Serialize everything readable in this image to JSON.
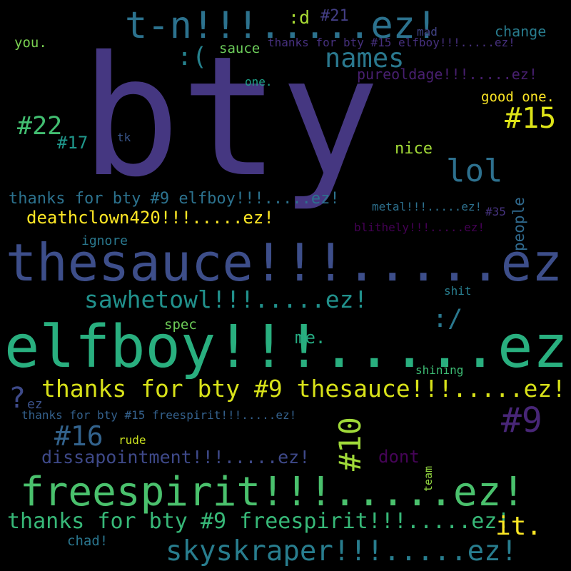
{
  "words": [
    {
      "text": "bty",
      "color": "#453781"
    },
    {
      "text": "thesauce!!!.....ez!",
      "color": "#3d4e8a"
    },
    {
      "text": "elfboy!!!.....ez!",
      "color": "#29af7f"
    },
    {
      "text": "freespirit!!!.....ez!",
      "color": "#4ac16d"
    },
    {
      "text": "t-n!!!.....ez!",
      "color": "#2c728e"
    },
    {
      "text": "thanks for bty #9 thesauce!!!.....ez!",
      "color": "#d8e219"
    },
    {
      "text": "skyskraper!!!.....ez!",
      "color": "#287d8e"
    },
    {
      "text": "thanks for bty #9 freespirit!!!.....ez!",
      "color": "#37b878"
    },
    {
      "text": "sawhetowl!!!.....ez!",
      "color": "#21918c"
    },
    {
      "text": "names",
      "color": "#2a788e"
    },
    {
      "text": "lol",
      "color": "#2d708e"
    },
    {
      "text": "#15",
      "color": "#dde318"
    },
    {
      "text": "#22",
      "color": "#42be71"
    },
    {
      "text": "#9",
      "color": "#482677"
    },
    {
      "text": "#16",
      "color": "#33638d"
    },
    {
      "text": "#10",
      "color": "#a0da39"
    },
    {
      "text": "dissapointment!!!.....ez!",
      "color": "#3e4989"
    },
    {
      "text": "deathclown420!!!.....ez!",
      "color": "#fde725"
    },
    {
      "text": "thanks for bty #9 elfboy!!!.....ez!",
      "color": "#2c728e"
    },
    {
      "text": "it.",
      "color": "#fde725"
    },
    {
      "text": "?",
      "color": "#3e4a89"
    },
    {
      "text": ":(",
      "color": "#26828e"
    },
    {
      "text": ":/",
      "color": "#2a788e"
    },
    {
      "text": ":d",
      "color": "#a8db34"
    },
    {
      "text": "#21",
      "color": "#433e85"
    },
    {
      "text": "mad",
      "color": "#414487"
    },
    {
      "text": "change",
      "color": "#287c8e"
    },
    {
      "text": "you.",
      "color": "#7ad151"
    },
    {
      "text": "sauce",
      "color": "#6ccd5a"
    },
    {
      "text": "thanks for bty #15 elfboy!!!.....ez!",
      "color": "#46307e"
    },
    {
      "text": "one.",
      "color": "#1fa088"
    },
    {
      "text": "pureoldage!!!.....ez!",
      "color": "#481f70"
    },
    {
      "text": "good one.",
      "color": "#fde725"
    },
    {
      "text": "#17",
      "color": "#1f978b"
    },
    {
      "text": "tk",
      "color": "#39568c"
    },
    {
      "text": "nice",
      "color": "#a2da37"
    },
    {
      "text": "people",
      "color": "#306a8e"
    },
    {
      "text": "metal!!!.....ez!",
      "color": "#2d708e"
    },
    {
      "text": "#35",
      "color": "#46337f"
    },
    {
      "text": "ignore",
      "color": "#2a788e"
    },
    {
      "text": "blithely!!!.....ez!",
      "color": "#440154"
    },
    {
      "text": "shit",
      "color": "#287d8e"
    },
    {
      "text": "spec",
      "color": "#6ece58"
    },
    {
      "text": "me.",
      "color": "#25ab82"
    },
    {
      "text": "shining",
      "color": "#3dbc74"
    },
    {
      "text": "ez",
      "color": "#3b528b"
    },
    {
      "text": "thanks for bty #15 freespirit!!!.....ez!",
      "color": "#34618d"
    },
    {
      "text": "dont",
      "color": "#450457"
    },
    {
      "text": "rude",
      "color": "#cae11f"
    },
    {
      "text": "team",
      "color": "#93d741"
    },
    {
      "text": "chad!",
      "color": "#2a768e"
    }
  ]
}
